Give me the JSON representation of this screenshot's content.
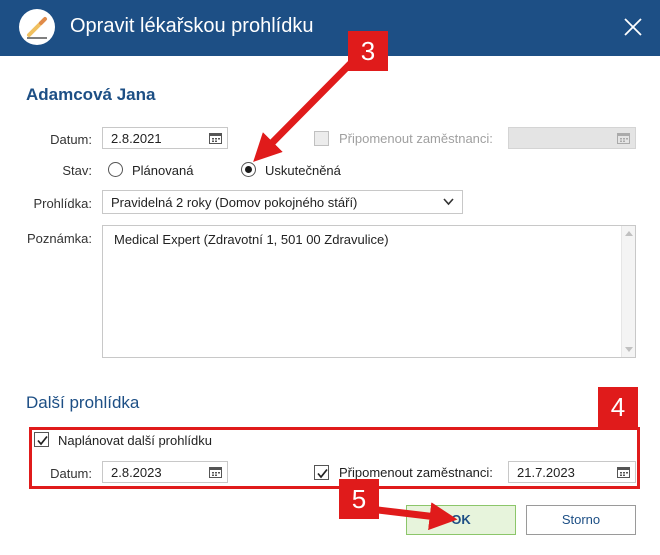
{
  "window": {
    "title": "Opravit lékařskou prohlídku"
  },
  "employee": {
    "name": "Adamcová Jana"
  },
  "form": {
    "date_label": "Datum:",
    "date_value": "2.8.2021",
    "remind_label": "Připomenout zaměstnanci:",
    "remind_checked": false,
    "remind_disabled": true,
    "remind_date_value": "",
    "status_label": "Stav:",
    "status_options": [
      "Plánovaná",
      "Uskutečněná"
    ],
    "status_selected": "Uskutečněná",
    "exam_label": "Prohlídka:",
    "exam_value": "Pravidelná 2 roky (Domov pokojného stáří)",
    "note_label": "Poznámka:",
    "note_value": "Medical Expert (Zdravotní 1, 501 00 Zdravulice)"
  },
  "next_exam": {
    "section_title": "Další prohlídka",
    "plan_label": "Naplánovat další prohlídku",
    "plan_checked": true,
    "date_label": "Datum:",
    "date_value": "2.8.2023",
    "remind_label": "Připomenout zaměstnanci:",
    "remind_checked": true,
    "remind_date_value": "21.7.2023"
  },
  "buttons": {
    "ok": "OK",
    "cancel": "Storno"
  },
  "annotations": {
    "step3": "3",
    "step4": "4",
    "step5": "5"
  },
  "colors": {
    "titlebar": "#1d4f85",
    "accent": "#1d4f85",
    "annotation_red": "#e01b1b",
    "ok_button": "#e7f4dc"
  },
  "icons": {
    "app": "pencil-icon",
    "close": "close-icon",
    "calendar": "calendar-icon",
    "dropdown": "chevron-down-icon",
    "check": "checkmark-icon"
  }
}
